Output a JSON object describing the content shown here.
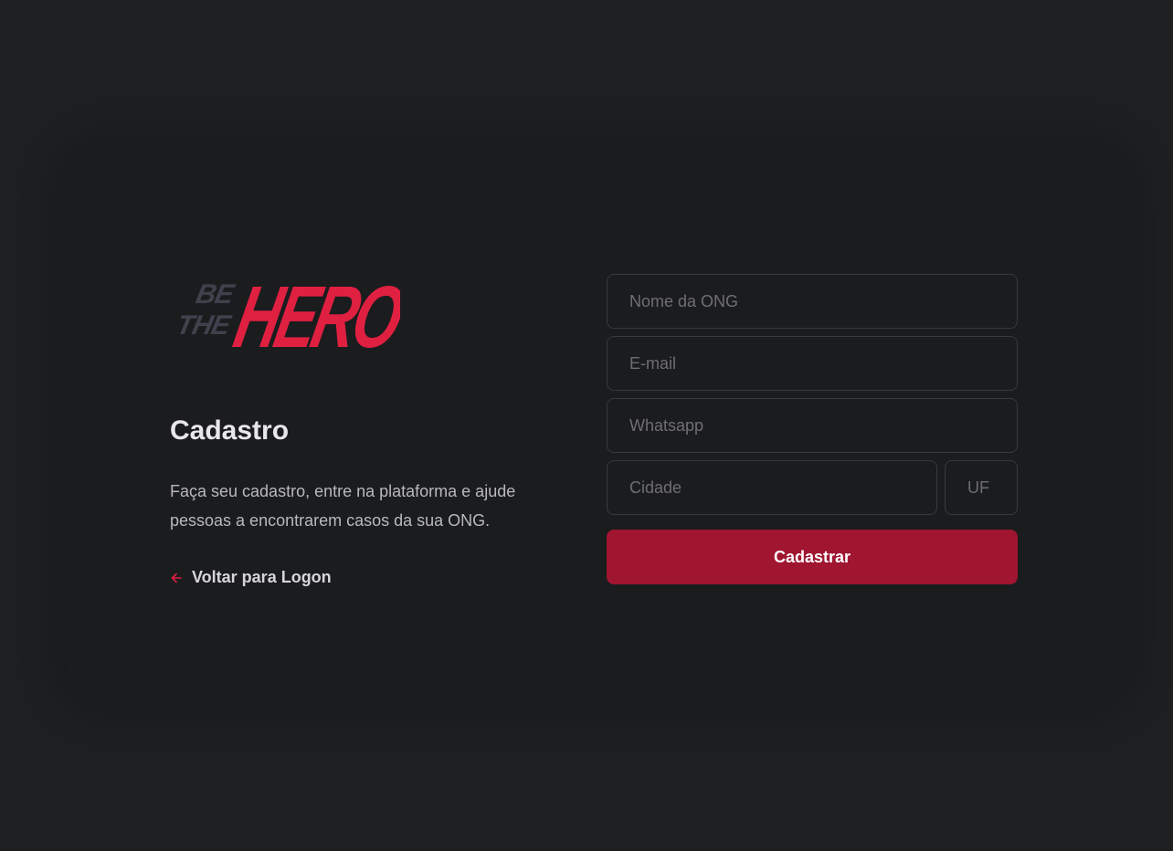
{
  "brand": {
    "logo_text_small": "BE THE",
    "logo_text_large": "HERO",
    "colors": {
      "accent": "#e02041",
      "logo_gray": "#41414d",
      "button": "#a01530"
    }
  },
  "intro": {
    "title": "Cadastro",
    "description": "Faça seu cadastro, entre na plataforma e ajude pessoas a encontrarem casos da sua ONG.",
    "back_link": {
      "label": "Voltar para Logon",
      "icon": "arrow-left-icon"
    }
  },
  "form": {
    "name_placeholder": "Nome da ONG",
    "email_placeholder": "E-mail",
    "whatsapp_placeholder": "Whatsapp",
    "city_placeholder": "Cidade",
    "uf_placeholder": "UF",
    "submit_label": "Cadastrar"
  }
}
